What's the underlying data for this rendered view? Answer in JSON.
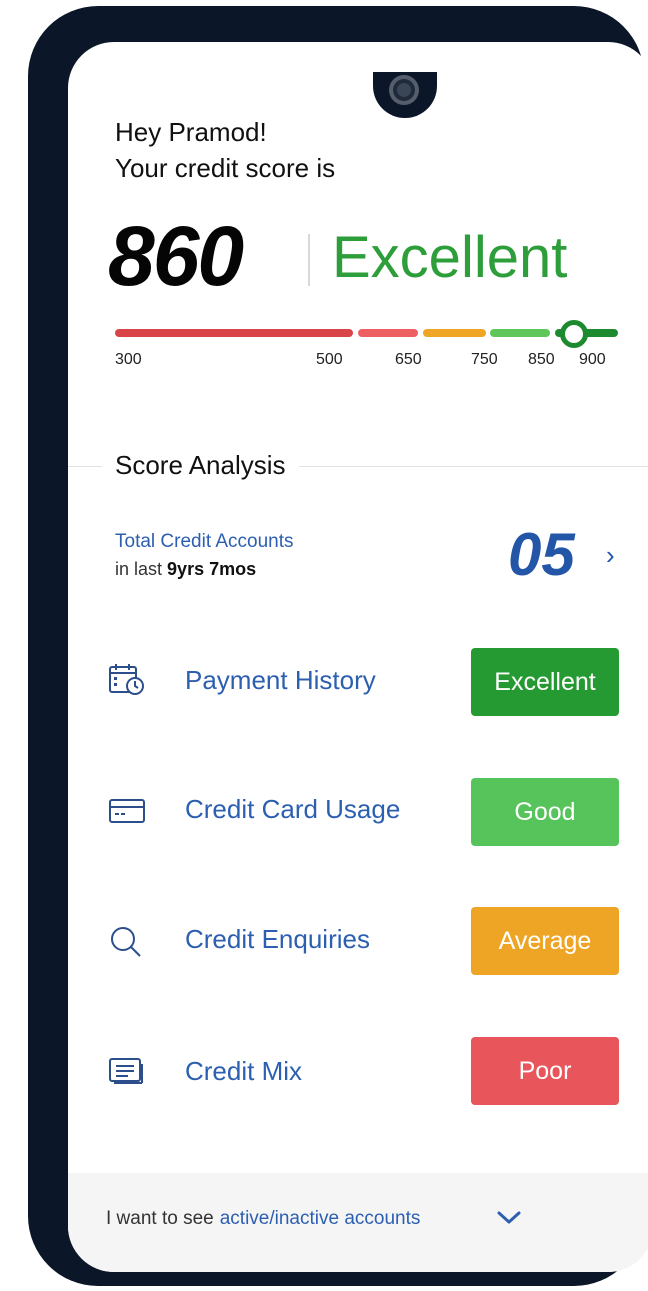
{
  "header": {
    "greeting_line1": "Hey Pramod!",
    "greeting_line2": "Your credit score is"
  },
  "score": {
    "value": "860",
    "rating": "Excellent",
    "rating_color": "#2d9e3a",
    "scale_min": 300,
    "scale_max": 900,
    "ticks": [
      "300",
      "500",
      "650",
      "750",
      "850",
      "900"
    ],
    "segments": [
      {
        "from": 300,
        "to": 500,
        "color": "#d94448"
      },
      {
        "from": 500,
        "to": 650,
        "color": "#ee5f62"
      },
      {
        "from": 650,
        "to": 750,
        "color": "#efa526"
      },
      {
        "from": 750,
        "to": 850,
        "color": "#5fc65a"
      },
      {
        "from": 850,
        "to": 900,
        "color": "#1e8a30"
      }
    ]
  },
  "analysis": {
    "title": "Score Analysis",
    "total_accounts_label": "Total Credit Accounts",
    "in_last_prefix": "in last",
    "in_last_value": "9yrs 7mos",
    "total_accounts_count": "05",
    "factors": [
      {
        "label": "Payment History",
        "icon": "calendar-clock-icon",
        "status": "Excellent",
        "status_color": "#269a32"
      },
      {
        "label": "Credit Card Usage",
        "icon": "credit-card-icon",
        "status": "Good",
        "status_color": "#56c45a"
      },
      {
        "label": "Credit Enquiries",
        "icon": "search-icon",
        "status": "Average",
        "status_color": "#eea424"
      },
      {
        "label": "Credit Mix",
        "icon": "document-icon",
        "status": "Poor",
        "status_color": "#e8555a"
      }
    ]
  },
  "footer": {
    "prefix": "I want to see",
    "link": "active/inactive accounts"
  }
}
